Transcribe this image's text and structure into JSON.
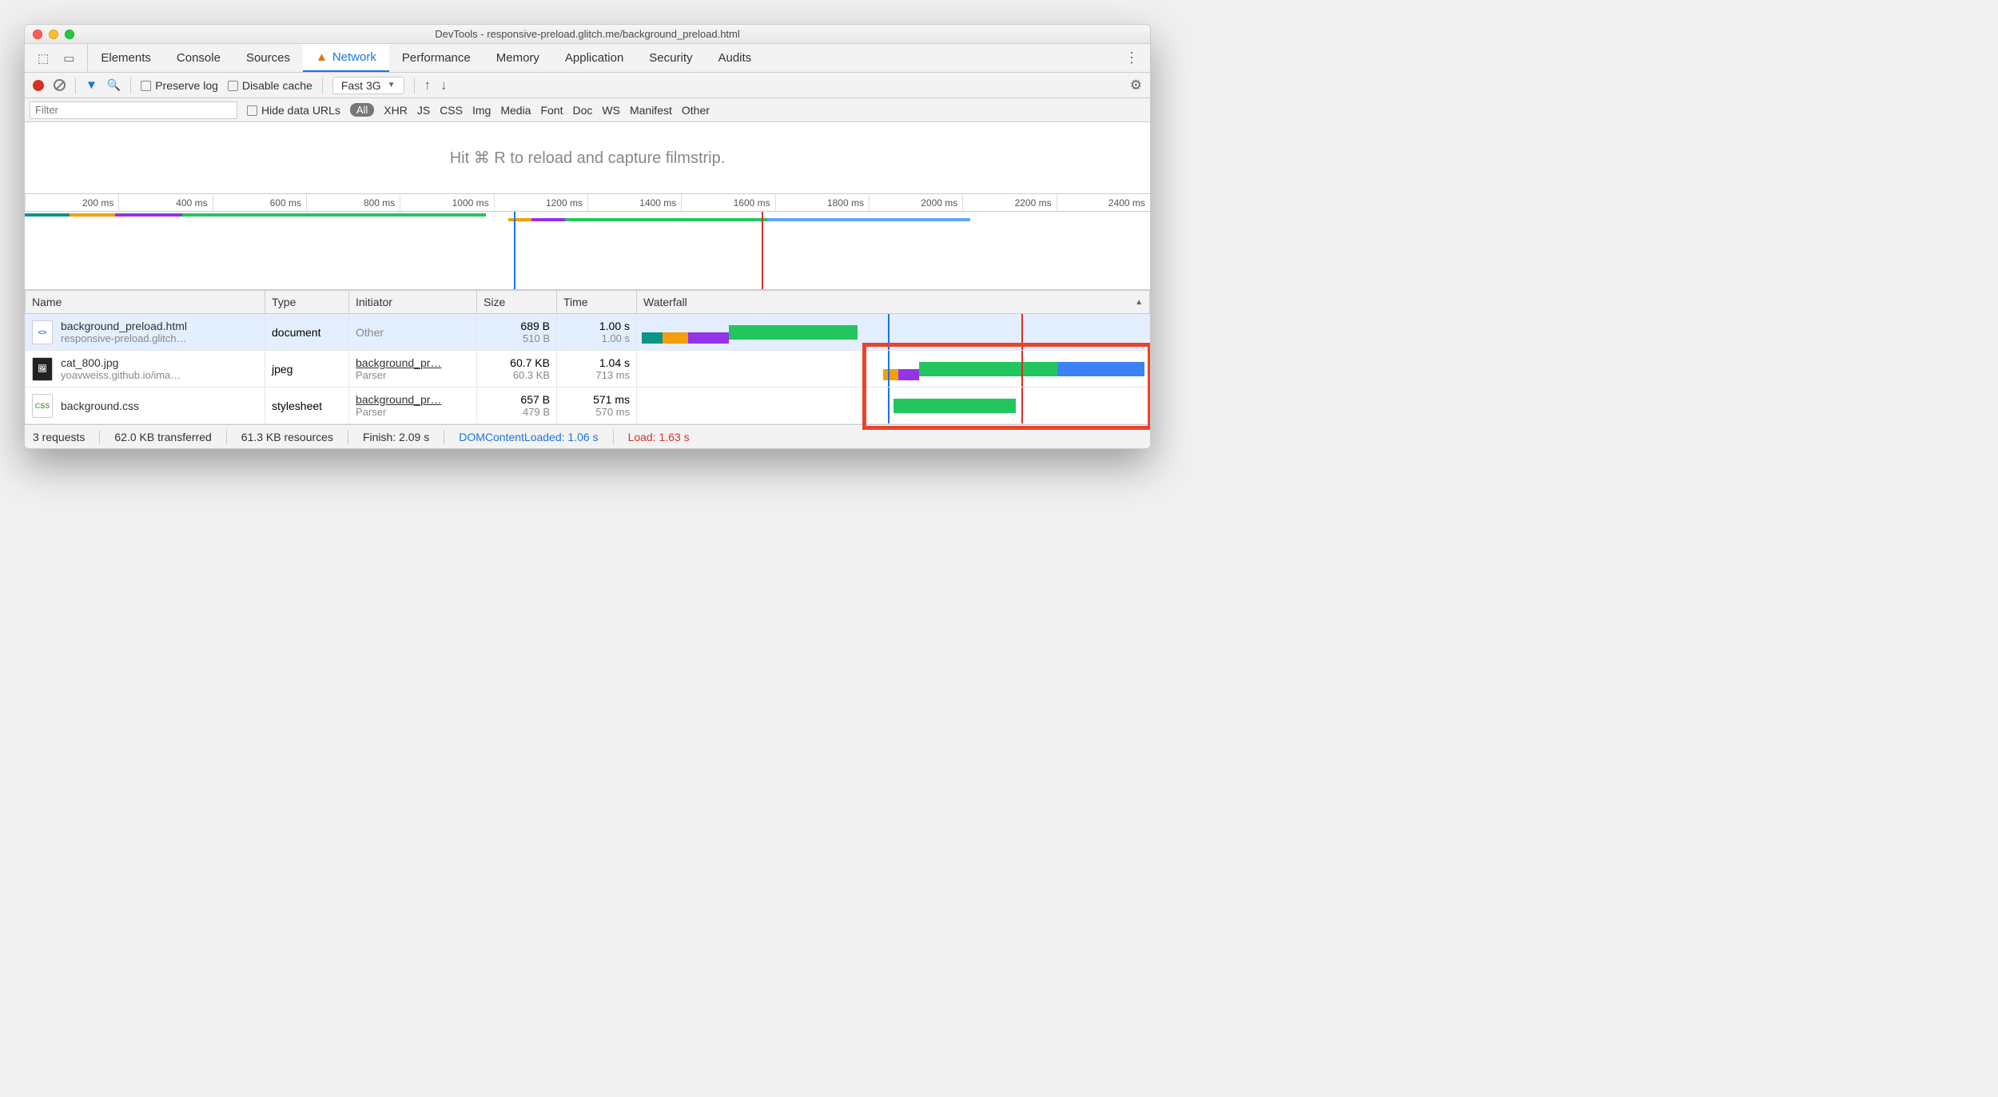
{
  "window": {
    "title": "DevTools - responsive-preload.glitch.me/background_preload.html"
  },
  "tabs": {
    "items": [
      "Elements",
      "Console",
      "Sources",
      "Network",
      "Performance",
      "Memory",
      "Application",
      "Security",
      "Audits"
    ],
    "active": "Network"
  },
  "toolbar": {
    "preserve_log": "Preserve log",
    "disable_cache": "Disable cache",
    "throttle": "Fast 3G"
  },
  "filter": {
    "placeholder": "Filter",
    "hide_data_urls": "Hide data URLs",
    "all": "All",
    "types": [
      "XHR",
      "JS",
      "CSS",
      "Img",
      "Media",
      "Font",
      "Doc",
      "WS",
      "Manifest",
      "Other"
    ]
  },
  "filmstrip": {
    "hint": "Hit ⌘ R to reload and capture filmstrip."
  },
  "overview_ticks": [
    "200 ms",
    "400 ms",
    "600 ms",
    "800 ms",
    "1000 ms",
    "1200 ms",
    "1400 ms",
    "1600 ms",
    "1800 ms",
    "2000 ms",
    "2200 ms",
    "2400 ms"
  ],
  "table": {
    "headers": {
      "name": "Name",
      "type": "Type",
      "initiator": "Initiator",
      "size": "Size",
      "time": "Time",
      "waterfall": "Waterfall"
    },
    "rows": [
      {
        "name": "background_preload.html",
        "sub": "responsive-preload.glitch…",
        "type": "document",
        "initiator": "Other",
        "initiator_sub": "",
        "size": "689 B",
        "size_sub": "510 B",
        "time": "1.00 s",
        "time_sub": "1.00 s",
        "selected": true
      },
      {
        "name": "cat_800.jpg",
        "sub": "yoavweiss.github.io/ima…",
        "type": "jpeg",
        "initiator": "background_pr…",
        "initiator_sub": "Parser",
        "size": "60.7 KB",
        "size_sub": "60.3 KB",
        "time": "1.04 s",
        "time_sub": "713 ms",
        "selected": false
      },
      {
        "name": "background.css",
        "sub": "",
        "type": "stylesheet",
        "initiator": "background_pr…",
        "initiator_sub": "Parser",
        "size": "657 B",
        "size_sub": "479 B",
        "time": "571 ms",
        "time_sub": "570 ms",
        "selected": false
      }
    ]
  },
  "status": {
    "requests": "3 requests",
    "transferred": "62.0 KB transferred",
    "resources": "61.3 KB resources",
    "finish": "Finish: 2.09 s",
    "dcl": "DOMContentLoaded: 1.06 s",
    "load": "Load: 1.63 s"
  }
}
